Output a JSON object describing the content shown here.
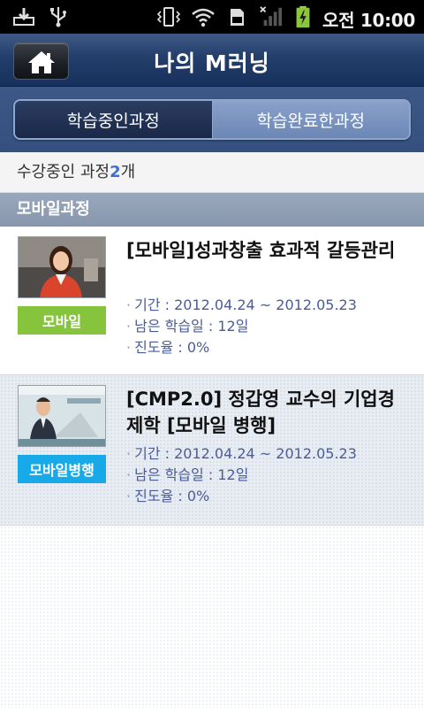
{
  "status_bar": {
    "time": "오전 10:00",
    "icons": [
      "download-icon",
      "usb-icon",
      "vibrate-icon",
      "wifi-icon",
      "sd-card-icon",
      "signal-icon",
      "battery-charging-icon"
    ]
  },
  "header": {
    "title": "나의 M러닝",
    "home_icon": "home-icon"
  },
  "tabs": [
    {
      "label": "학습중인과정",
      "active": true
    },
    {
      "label": "학습완료한과정",
      "active": false
    }
  ],
  "count_bar": {
    "prefix": "수강중인 과정",
    "count": "2",
    "suffix": "개"
  },
  "section": {
    "title": "모바일과정"
  },
  "courses": [
    {
      "title": "[모바일]성과창출 효과적 갈등관리",
      "badge": "모바일",
      "badge_color": "#86c43d",
      "period_label": "기간 : ",
      "period": "2012.04.24 ~ 2012.05.23",
      "remaining_label": "남은 학습일 : ",
      "remaining": "12일",
      "progress_label": "진도율 : ",
      "progress": "0%"
    },
    {
      "title": "[CMP2.0] 정갑영 교수의 기업경제학 [모바일 병행]",
      "badge": "모바일병행",
      "badge_color": "#17a9e8",
      "period_label": "기간 : ",
      "period": "2012.04.24 ~ 2012.05.23",
      "remaining_label": "남은 학습일 : ",
      "remaining": "12일",
      "progress_label": "진도율 : ",
      "progress": "0%"
    }
  ]
}
